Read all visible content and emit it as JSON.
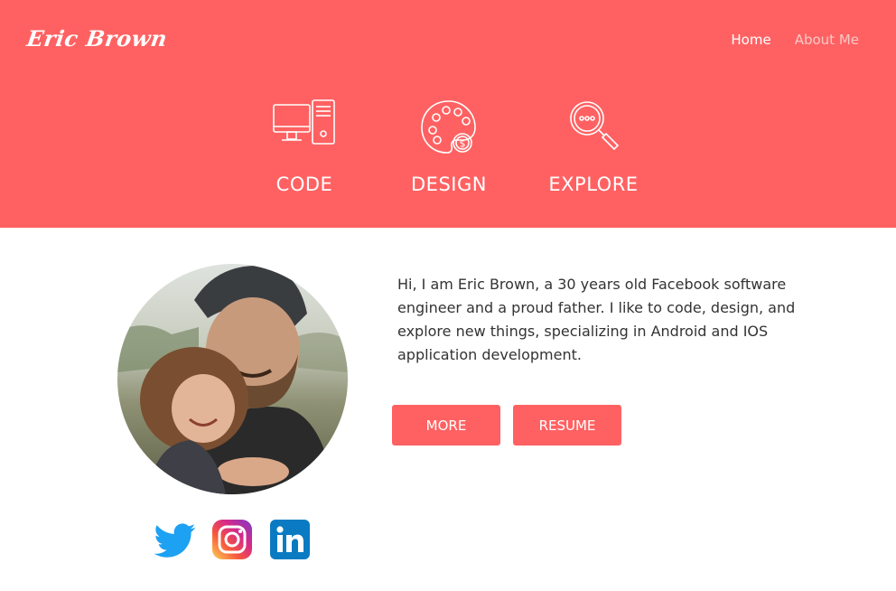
{
  "brand": {
    "name": "Eric Brown"
  },
  "nav": {
    "items": [
      {
        "label": "Home"
      },
      {
        "label": "About Me"
      }
    ]
  },
  "features": [
    {
      "label": "CODE",
      "icon": "computer-icon"
    },
    {
      "label": "DESIGN",
      "icon": "palette-icon"
    },
    {
      "label": "EXPLORE",
      "icon": "magnifier-icon"
    }
  ],
  "profile": {
    "photo": "profile-photo",
    "bio": "Hi, I am Eric Brown, a 30 years old Facebook software engineer and a proud father. I like to code, design, and explore new things, specializing in Android and IOS application development."
  },
  "buttons": {
    "more": "MORE",
    "resume": "RESUME"
  },
  "social": [
    {
      "icon": "twitter-icon"
    },
    {
      "icon": "instagram-icon"
    },
    {
      "icon": "linkedin-icon"
    }
  ],
  "colors": {
    "accent": "#ff6162",
    "text": "#333333",
    "nav_muted": "#f7c9c6",
    "twitter": "#1da1f2",
    "linkedin": "#0a7bc2"
  }
}
